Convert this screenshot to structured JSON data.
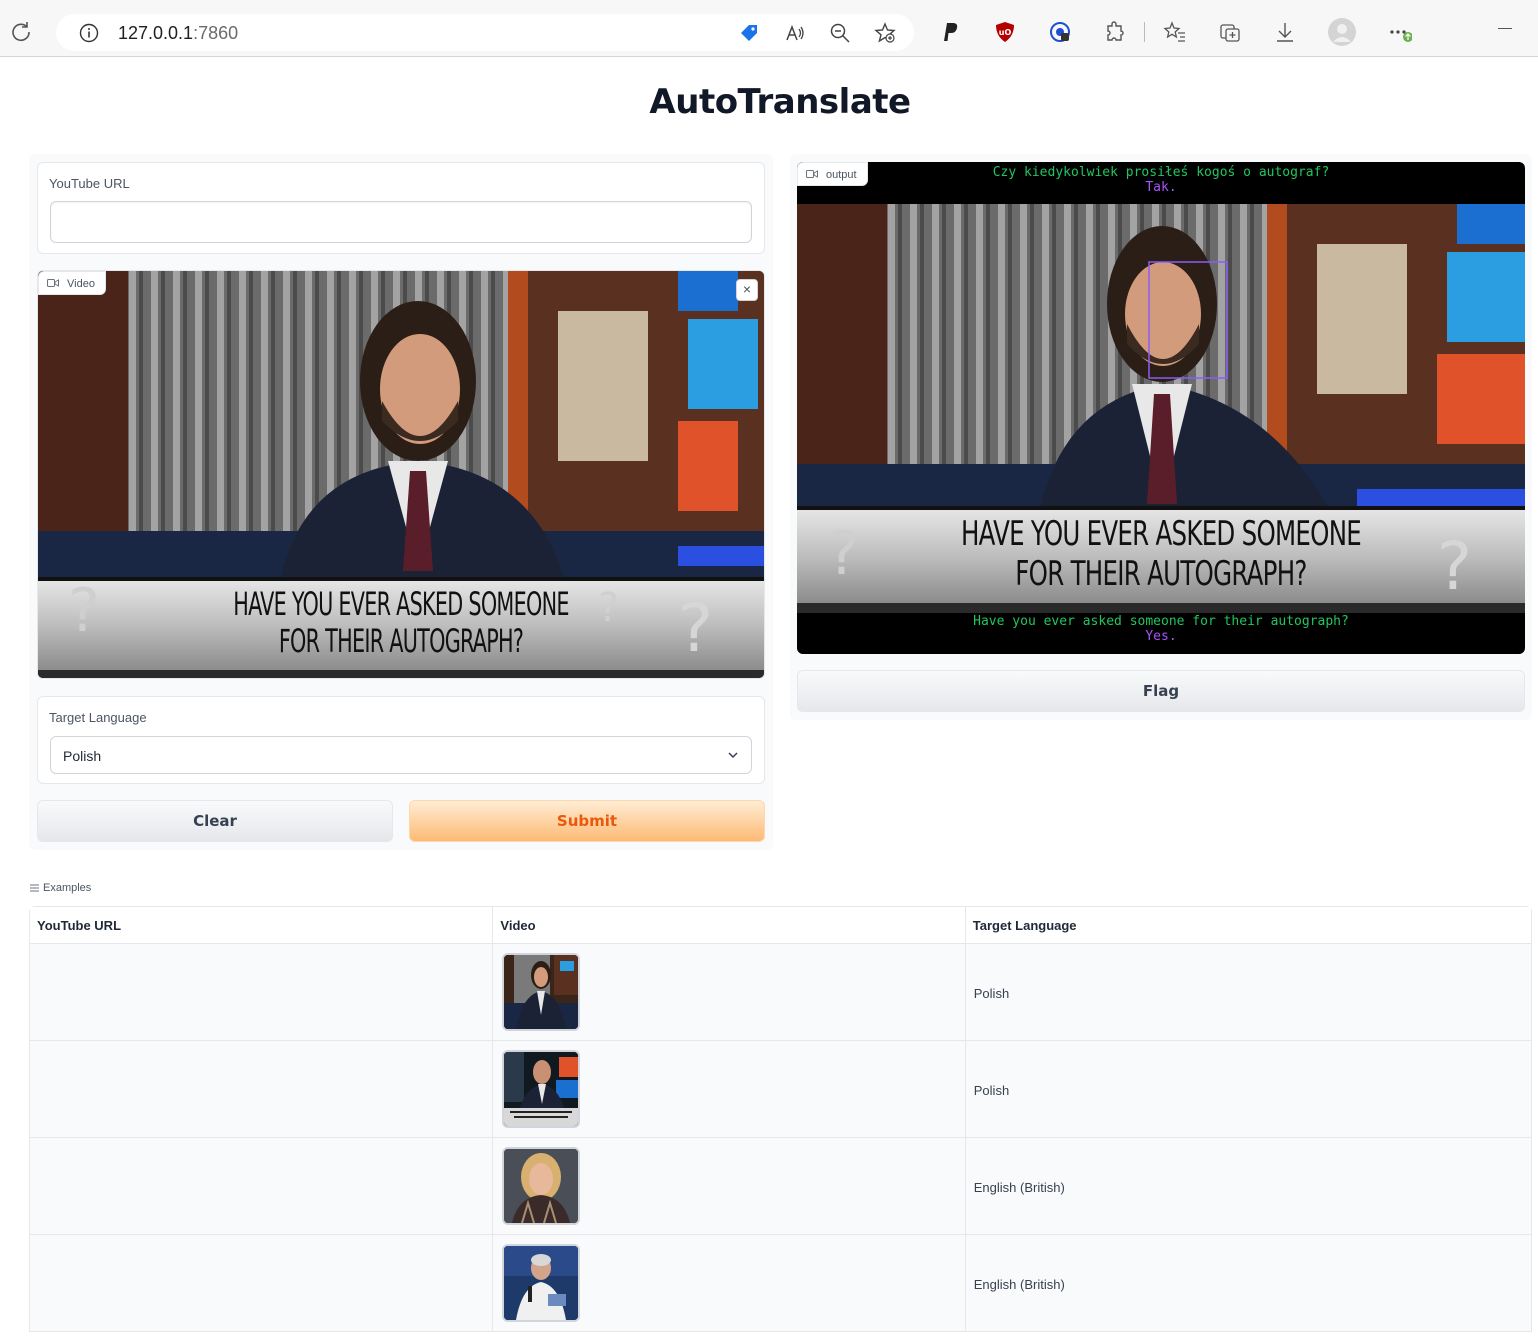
{
  "browser": {
    "url_host": "127.0.0.1",
    "url_port": ":7860"
  },
  "app": {
    "title": "AutoTranslate"
  },
  "inputs": {
    "youtube_label": "YouTube URL",
    "youtube_value": "",
    "video_label": "Video",
    "video_caption_line1": "HAVE YOU EVER ASKED SOMEONE",
    "video_caption_line2": "FOR THEIR AUTOGRAPH?",
    "language_label": "Target Language",
    "language_value": "Polish",
    "clear_label": "Clear",
    "submit_label": "Submit"
  },
  "output": {
    "label": "output",
    "top_line1": "Czy kiedykolwiek prosiłeś kogoś o autograf?",
    "top_line2": "Tak.",
    "bottom_line1": "Have you ever asked someone for their autograph?",
    "bottom_line2": "Yes.",
    "flag_label": "Flag"
  },
  "examples": {
    "heading": "Examples",
    "columns": [
      "YouTube URL",
      "Video",
      "Target Language"
    ],
    "rows": [
      {
        "url": "",
        "language": "Polish"
      },
      {
        "url": "",
        "language": "Polish"
      },
      {
        "url": "",
        "language": "English (British)"
      },
      {
        "url": "",
        "language": "English (British)"
      }
    ]
  }
}
